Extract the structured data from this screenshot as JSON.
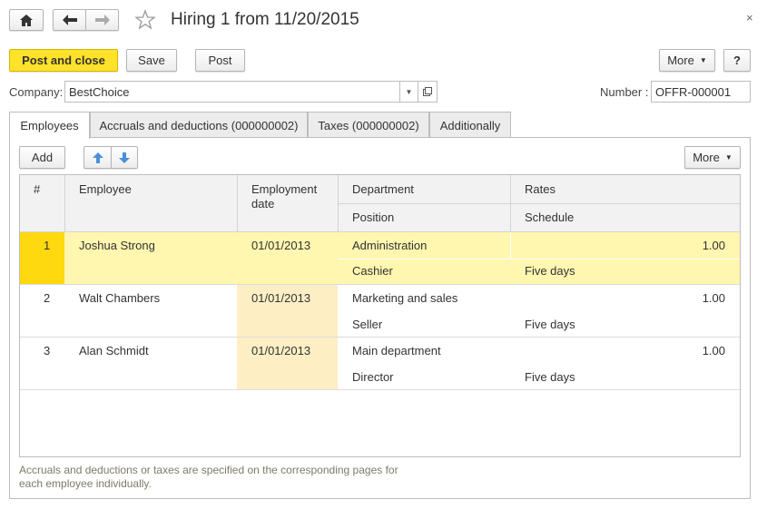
{
  "window": {
    "title": "Hiring 1 from 11/20/2015",
    "close_glyph": "×"
  },
  "toolbar": {
    "post_and_close": "Post and close",
    "save": "Save",
    "post": "Post",
    "more": "More",
    "help": "?"
  },
  "form": {
    "company_label": "Company:",
    "company_value": "BestChoice",
    "number_label": "Number :",
    "number_value": "OFFR-000001"
  },
  "tabs": [
    {
      "label": "Employees",
      "active": true
    },
    {
      "label": "Accruals and deductions (000000002)",
      "active": false
    },
    {
      "label": "Taxes (000000002)",
      "active": false
    },
    {
      "label": "Additionally",
      "active": false
    }
  ],
  "table_toolbar": {
    "add": "Add",
    "more": "More"
  },
  "table": {
    "headers": {
      "num": "#",
      "employee": "Employee",
      "employment_date": "Employment date",
      "department": "Department",
      "position": "Position",
      "rates": "Rates",
      "schedule": "Schedule"
    },
    "rows": [
      {
        "num": "1",
        "employee": "Joshua Strong",
        "date": "01/01/2013",
        "department": "Administration",
        "position": "Cashier",
        "rate": "1.00",
        "schedule": "Five days",
        "selected": true
      },
      {
        "num": "2",
        "employee": "Walt Chambers",
        "date": "01/01/2013",
        "department": "Marketing and sales",
        "position": "Seller",
        "rate": "1.00",
        "schedule": "Five days",
        "selected": false
      },
      {
        "num": "3",
        "employee": "Alan Schmidt",
        "date": "01/01/2013",
        "department": "Main department",
        "position": "Director",
        "rate": "1.00",
        "schedule": "Five days",
        "selected": false
      }
    ]
  },
  "note": "Accruals and deductions or taxes are specified on the corresponding pages for each employee individually.",
  "colors": {
    "accent": "#ffe22a",
    "selected_row": "#fff6b0",
    "selected_num": "#ffd90f",
    "date_column": "#fdeec4",
    "note_text": "#7d7b68"
  }
}
